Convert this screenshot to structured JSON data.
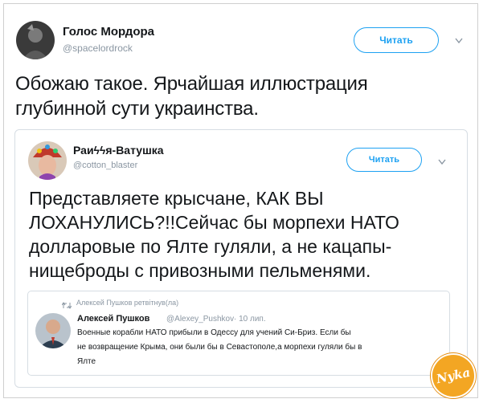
{
  "tweet": {
    "author_name": "Голос Мордора",
    "author_handle": "@spacelordrock",
    "follow_label": "Читать",
    "text_line1": "Обожаю такое. Ярчайшая иллюстрация",
    "text_line2": "глубинной сути украинства."
  },
  "quoted": {
    "author_name": "Раиϟϟя-Ватушка",
    "author_handle": "@cotton_blaster",
    "follow_label": "Читать",
    "lines": [
      "Представляете крысчане, КАК ВЫ",
      "ЛОХАНУЛИСЬ?!!Сейчас бы морпехи НАТО",
      "долларовые по Ялте гуляли, а не кацапы-",
      "нищеброды с привозными пельменями."
    ]
  },
  "nested": {
    "retweet_label": "Алексей Пушков ретвітнув(ла)",
    "author_name": "Алексей Пушков",
    "author_handle": "@Alexey_Pushkov",
    "time": "· 10 лип.",
    "lines": [
      "Военные корабли НАТО прибыли в Одессу для учений Си-Бриз. Если бы",
      "не возвращение Крыма, они были бы в Севастополе,а морпехи гуляли бы в",
      "Ялте"
    ]
  },
  "sticker": {
    "label": "Nyka"
  },
  "colors": {
    "accent": "#1da1f2",
    "muted": "#8a96a2",
    "sticker": "#f3a623"
  }
}
